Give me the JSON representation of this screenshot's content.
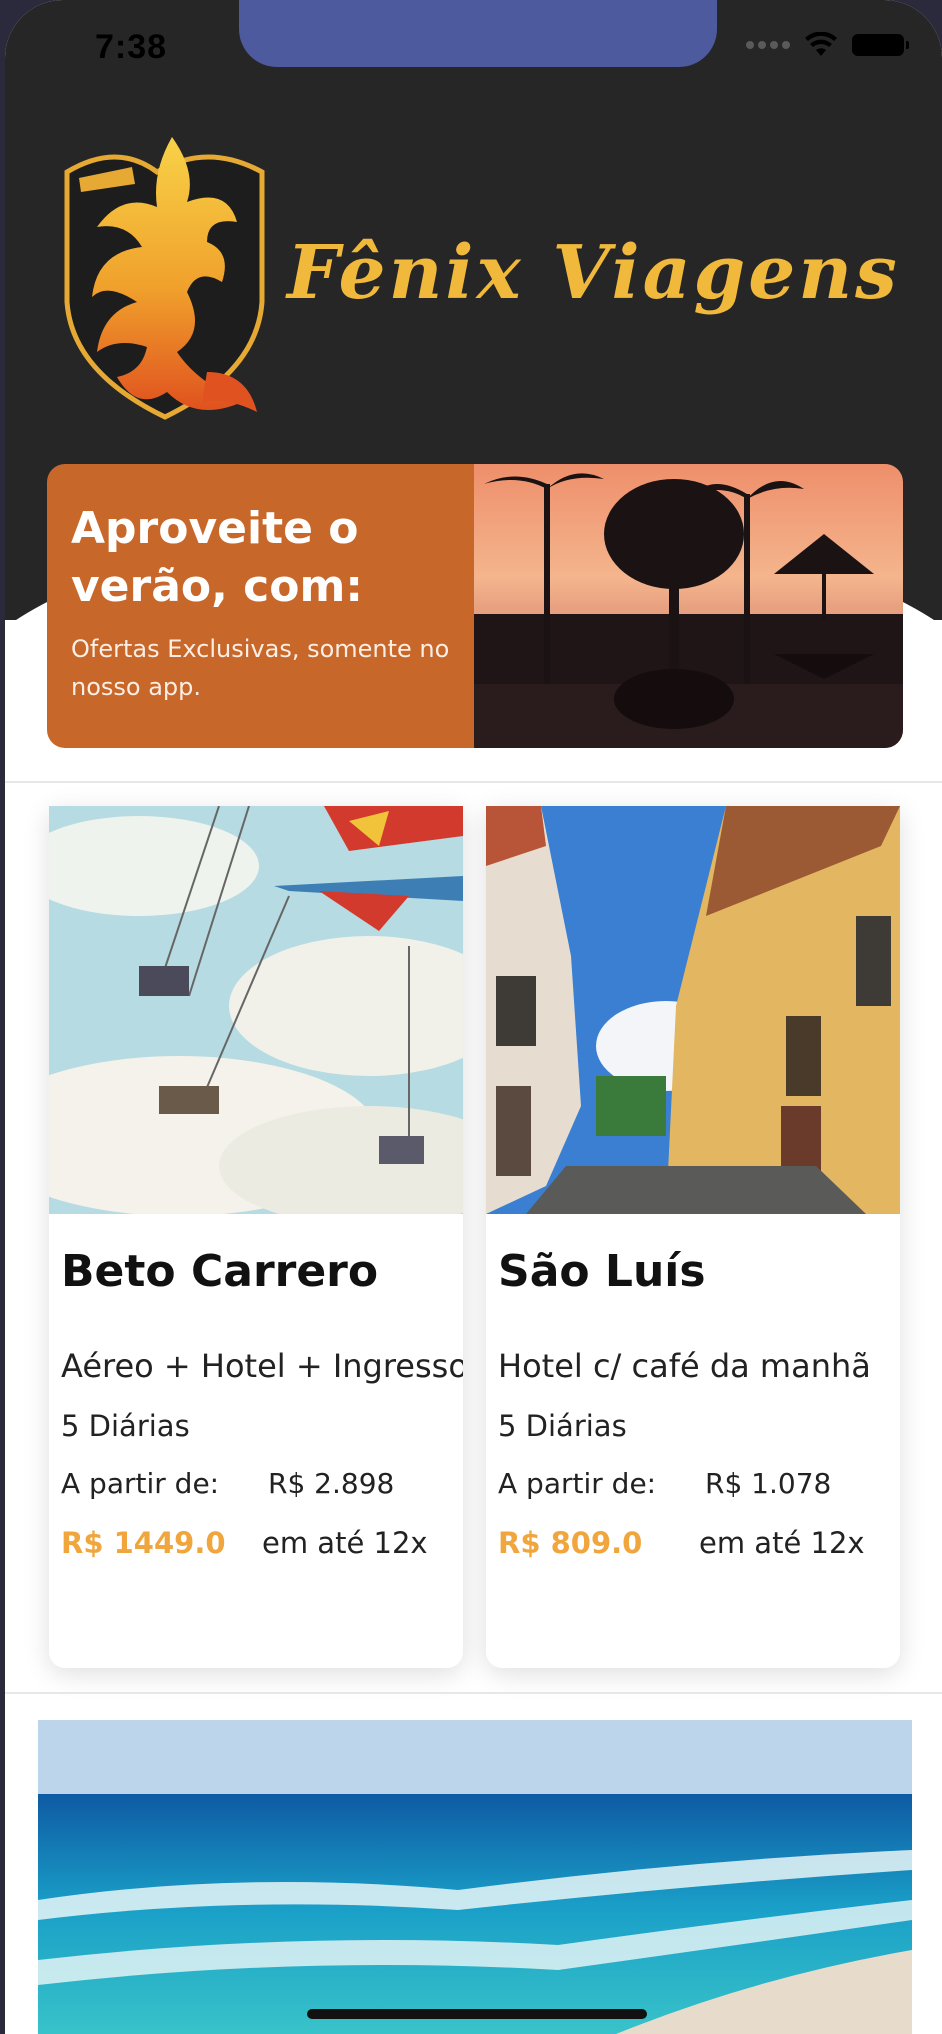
{
  "status_bar": {
    "time": "7:38"
  },
  "header": {
    "brand": "Fênix Viagens",
    "logo_text": "Fenix"
  },
  "promo": {
    "title": "Aproveite o verão, com:",
    "subtitle": "Ofertas Exclusivas, somente no nosso app."
  },
  "offers": [
    {
      "title": "Beto Carrero",
      "package": "Aéreo + Hotel + Ingresso",
      "days": "5 Diárias",
      "from_label": "A partir de:",
      "original_price": "R$ 2.898",
      "price": "R$ 1449.0",
      "installments": "em até 12x"
    },
    {
      "title": "São Luís",
      "package": "Hotel c/ café da manhã",
      "days": "5 Diárias",
      "from_label": "A partir de:",
      "original_price": "R$ 1.078",
      "price": "R$ 809.0",
      "installments": "em até 12x"
    }
  ],
  "colors": {
    "header": "#272626",
    "promo": "#c8672a",
    "price": "#f0a63c",
    "brand": "#f1b93c"
  }
}
